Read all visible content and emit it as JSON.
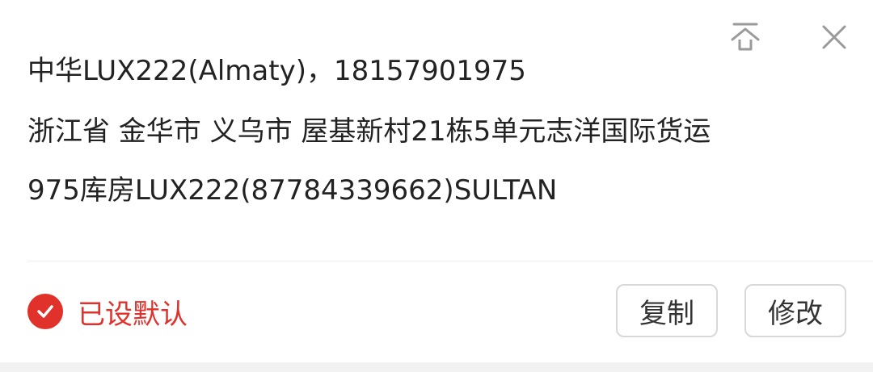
{
  "address": {
    "line1": "中华LUX222(Almaty)，18157901975",
    "line2": "浙江省 金华市 义乌市 屋基新村21栋5单元志洋国际货运",
    "line3": "975库房LUX222(87784339662)SULTAN"
  },
  "icons": {
    "pin_top": "pin-to-top-icon",
    "close": "close-icon",
    "check": "check-circle-icon"
  },
  "default_label": "已设默认",
  "buttons": {
    "copy_label": "复制",
    "edit_label": "修改"
  },
  "colors": {
    "accent": "#e0312b",
    "text": "#222222",
    "icon_gray": "#9a9a9a",
    "border": "#d8d8d8"
  }
}
